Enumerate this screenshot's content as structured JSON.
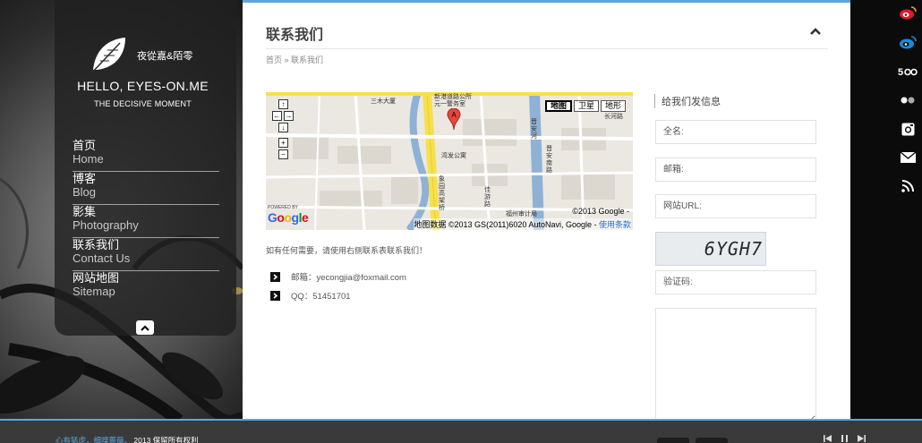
{
  "site": {
    "name": "夜從嘉&陌零",
    "hello": "HELLO, EYES-ON.ME",
    "tagline": "THE DECISIVE MOMENT"
  },
  "nav": [
    {
      "zh": "首页",
      "en": "Home"
    },
    {
      "zh": "博客",
      "en": "Blog"
    },
    {
      "zh": "影集",
      "en": "Photography"
    },
    {
      "zh": "联系我们",
      "en": "Contact Us"
    },
    {
      "zh": "网站地图",
      "en": "Sitemap"
    }
  ],
  "page": {
    "title": "联系我们",
    "breadcrumb": {
      "home": "首页",
      "sep": " » ",
      "current": "联系我们"
    },
    "intro": "如有任何需要，请使用右侧联系表联系我们！",
    "email": "邮箱：yecongjia@foxmail.com",
    "qq": "QQ：51451701"
  },
  "map": {
    "types": [
      "地图",
      "卫星",
      "地形"
    ],
    "active_type": "地图",
    "controls": {
      "up": "↑",
      "left": "←",
      "right": "→",
      "down": "↓",
      "zoom_in": "+",
      "zoom_out": "−"
    },
    "powered_by": "POWERED BY",
    "copyright": "©2013 Google -",
    "data_notice": "地图数据 ©2013 GS(2011)6020 AutoNavi, Google - ",
    "terms_link": "使用条款",
    "marker": "A",
    "labels": {
      "a": "三木大厦",
      "b": "新港道路公所\n元一警务室",
      "c": "湾发公寓",
      "d": "福州审计局",
      "e": "象园高架桥",
      "f": "晋安河",
      "g": "晋安南路",
      "h": "长河路",
      "i": "佳游路"
    }
  },
  "form": {
    "title": "给我们发信息",
    "name_placeholder": "全名:",
    "email_placeholder": "邮箱:",
    "url_placeholder": "网站URL:",
    "captcha_text": "6YGH7",
    "captcha_placeholder": "验证码:"
  },
  "footer": {
    "highlight": "心有猛虎，细嗅蔷薇。",
    "rest": "2013 保留所有权利"
  },
  "social": [
    "weibo-red-icon",
    "weibo-blue-icon",
    "500px-icon",
    "flickr-icon",
    "instagram-icon",
    "mail-icon",
    "rss-icon"
  ],
  "colors": {
    "accent": "#5aa7da",
    "panel": "#202020"
  }
}
